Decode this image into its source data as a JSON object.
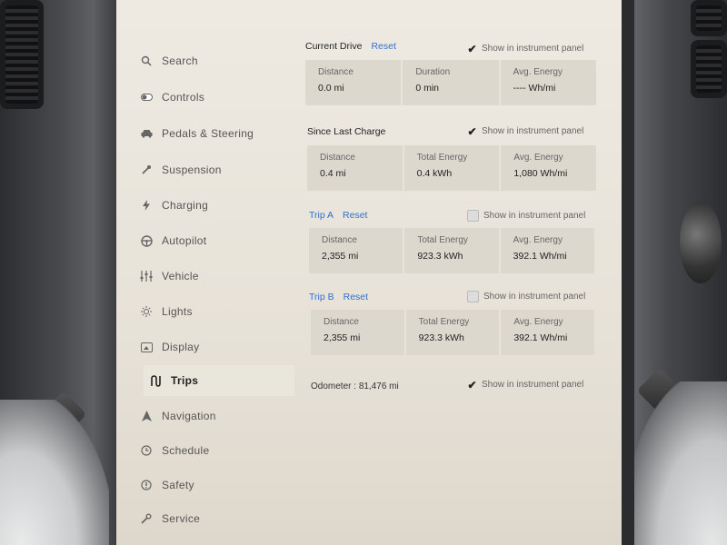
{
  "sidebar": {
    "items": [
      {
        "label": "Search",
        "icon": "search-icon"
      },
      {
        "label": "Controls",
        "icon": "toggle-icon"
      },
      {
        "label": "Pedals & Steering",
        "icon": "car-icon"
      },
      {
        "label": "Suspension",
        "icon": "wrench-icon"
      },
      {
        "label": "Charging",
        "icon": "bolt-icon"
      },
      {
        "label": "Autopilot",
        "icon": "steering-wheel-icon"
      },
      {
        "label": "Vehicle",
        "icon": "sliders-icon"
      },
      {
        "label": "Lights",
        "icon": "lightbulb-icon"
      },
      {
        "label": "Display",
        "icon": "display-icon"
      },
      {
        "label": "Trips",
        "icon": "trips-icon",
        "active": true
      },
      {
        "label": "Navigation",
        "icon": "navigation-arrow-icon"
      },
      {
        "label": "Schedule",
        "icon": "clock-icon"
      },
      {
        "label": "Safety",
        "icon": "alert-icon"
      },
      {
        "label": "Service",
        "icon": "wrench-icon"
      }
    ]
  },
  "toggle_label": "Show in instrument panel",
  "current_drive": {
    "title": "Current Drive",
    "reset": "Reset",
    "show_checked": true,
    "stats": [
      {
        "k": "Distance",
        "v": "0.0 mi"
      },
      {
        "k": "Duration",
        "v": "0 min"
      },
      {
        "k": "Avg. Energy",
        "v": "---- Wh/mi"
      }
    ]
  },
  "since_last_charge": {
    "title": "Since Last Charge",
    "show_checked": true,
    "stats": [
      {
        "k": "Distance",
        "v": "0.4 mi"
      },
      {
        "k": "Total Energy",
        "v": "0.4 kWh"
      },
      {
        "k": "Avg. Energy",
        "v": "1,080 Wh/mi"
      }
    ]
  },
  "trip_a": {
    "title": "Trip A",
    "reset": "Reset",
    "show_checked": false,
    "stats": [
      {
        "k": "Distance",
        "v": "2,355 mi"
      },
      {
        "k": "Total Energy",
        "v": "923.3 kWh"
      },
      {
        "k": "Avg. Energy",
        "v": "392.1 Wh/mi"
      }
    ]
  },
  "trip_b": {
    "title": "Trip B",
    "reset": "Reset",
    "show_checked": false,
    "stats": [
      {
        "k": "Distance",
        "v": "2,355 mi"
      },
      {
        "k": "Total Energy",
        "v": "923.3 kWh"
      },
      {
        "k": "Avg. Energy",
        "v": "392.1 Wh/mi"
      }
    ]
  },
  "odometer": {
    "label": "Odometer :",
    "value": "81,476 mi",
    "show_checked": true
  },
  "checkmark": "✔"
}
